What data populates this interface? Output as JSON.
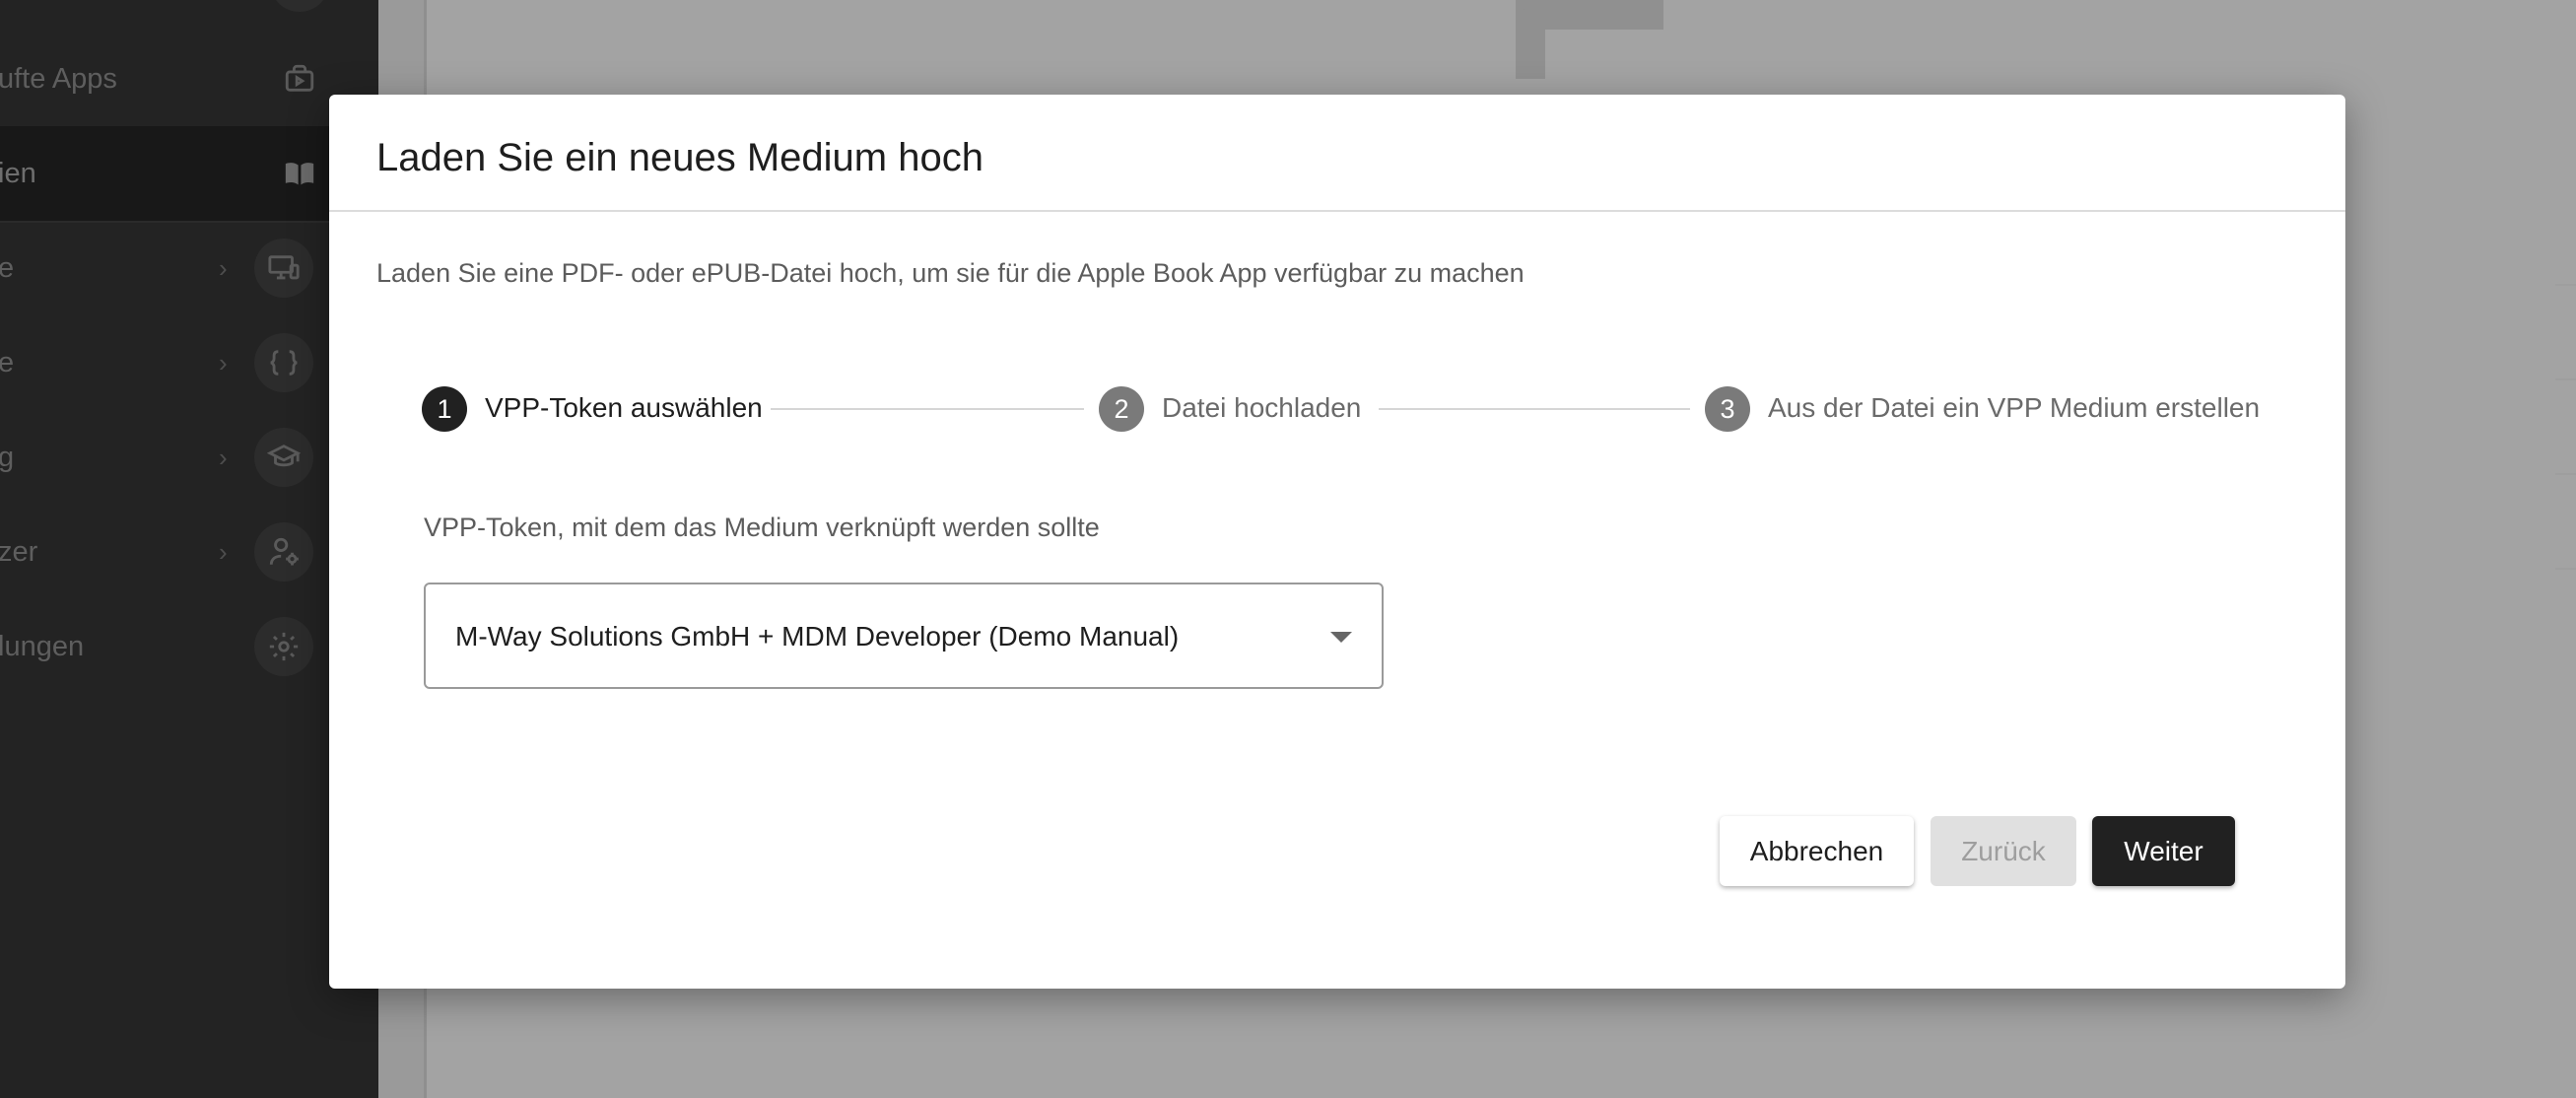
{
  "sidebar": {
    "items": [
      {
        "label": "ufte Apps",
        "icon": "app-store-icon",
        "chevron": false,
        "active": false
      },
      {
        "label": "ien",
        "icon": "book-icon",
        "chevron": false,
        "active": true
      },
      {
        "label": "e",
        "icon": "devices-icon",
        "chevron": true,
        "active": false
      },
      {
        "label": "e",
        "icon": "code-braces-icon",
        "chevron": true,
        "active": false
      },
      {
        "label": "g",
        "icon": "school-icon",
        "chevron": true,
        "active": false
      },
      {
        "label": "zer",
        "icon": "user-settings-icon",
        "chevron": true,
        "active": false
      },
      {
        "label": "lungen",
        "icon": "gear-icon",
        "chevron": false,
        "active": false
      }
    ]
  },
  "dialog": {
    "title": "Laden Sie ein neues Medium hoch",
    "description": "Laden Sie eine PDF- oder ePUB-Datei hoch, um sie für die Apple Book App verfügbar zu machen",
    "steps": [
      {
        "number": "1",
        "label": "VPP-Token auswählen",
        "active": true
      },
      {
        "number": "2",
        "label": "Datei hochladen",
        "active": false
      },
      {
        "number": "3",
        "label": "Aus der Datei ein VPP Medium erstellen",
        "active": false
      }
    ],
    "field_label": "VPP-Token, mit dem das Medium verknüpft werden sollte",
    "select_value": "M-Way Solutions GmbH + MDM Developer (Demo Manual)",
    "buttons": {
      "cancel": "Abbrechen",
      "back": "Zurück",
      "next": "Weiter"
    }
  },
  "colors": {
    "primary": "#212121",
    "overlay": "#9a9a9a",
    "sidebar_bg": "#232323"
  }
}
